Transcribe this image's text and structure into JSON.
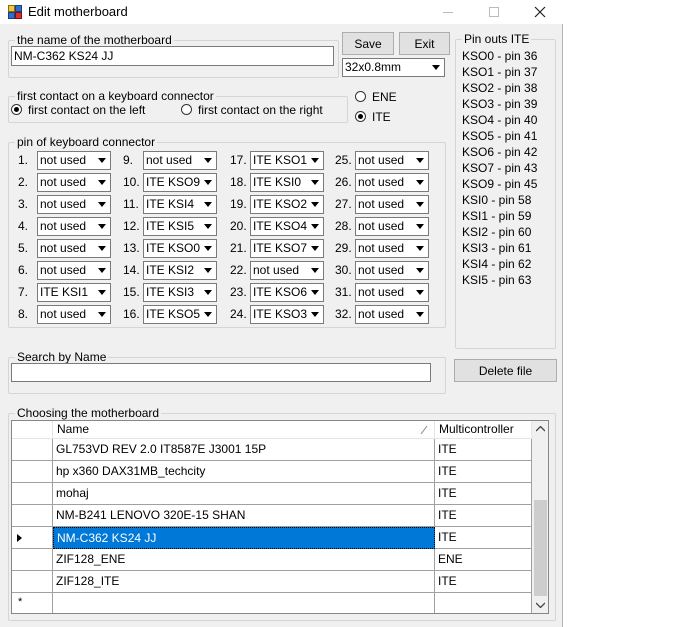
{
  "window": {
    "title": "Edit motherboard"
  },
  "name_group": {
    "legend": "the name of the motherboard",
    "value": "NM-C362 KS24 JJ"
  },
  "buttons": {
    "save": "Save",
    "exit": "Exit",
    "delete": "Delete file"
  },
  "package_select": {
    "value": "32x0.8mm"
  },
  "first_contact": {
    "legend": "first contact on a keyboard connector",
    "left_label": "first contact on the left",
    "right_label": "first contact on the right",
    "selected": "left"
  },
  "controller": {
    "ene_label": "ENE",
    "ite_label": "ITE",
    "selected": "ITE"
  },
  "pins": {
    "legend": "pin of keyboard connector",
    "items": [
      {
        "num": "1.",
        "value": "not used"
      },
      {
        "num": "2.",
        "value": "not used"
      },
      {
        "num": "3.",
        "value": "not used"
      },
      {
        "num": "4.",
        "value": "not used"
      },
      {
        "num": "5.",
        "value": "not used"
      },
      {
        "num": "6.",
        "value": "not used"
      },
      {
        "num": "7.",
        "value": "ITE KSI1"
      },
      {
        "num": "8.",
        "value": "not used"
      },
      {
        "num": "9.",
        "value": "not used"
      },
      {
        "num": "10.",
        "value": "ITE KSO9"
      },
      {
        "num": "11.",
        "value": "ITE KSI4"
      },
      {
        "num": "12.",
        "value": "ITE KSI5"
      },
      {
        "num": "13.",
        "value": "ITE KSO0"
      },
      {
        "num": "14.",
        "value": "ITE KSI2"
      },
      {
        "num": "15.",
        "value": "ITE KSI3"
      },
      {
        "num": "16.",
        "value": "ITE KSO5"
      },
      {
        "num": "17.",
        "value": "ITE KSO1"
      },
      {
        "num": "18.",
        "value": "ITE KSI0"
      },
      {
        "num": "19.",
        "value": "ITE KSO2"
      },
      {
        "num": "20.",
        "value": "ITE KSO4"
      },
      {
        "num": "21.",
        "value": "ITE KSO7"
      },
      {
        "num": "22.",
        "value": "not used"
      },
      {
        "num": "23.",
        "value": "ITE KSO6"
      },
      {
        "num": "24.",
        "value": "ITE KSO3"
      },
      {
        "num": "25.",
        "value": "not used"
      },
      {
        "num": "26.",
        "value": "not used"
      },
      {
        "num": "27.",
        "value": "not used"
      },
      {
        "num": "28.",
        "value": "not used"
      },
      {
        "num": "29.",
        "value": "not used"
      },
      {
        "num": "30.",
        "value": "not used"
      },
      {
        "num": "31.",
        "value": "not used"
      },
      {
        "num": "32.",
        "value": "not used"
      }
    ]
  },
  "pinouts": {
    "legend": "Pin outs ITE",
    "lines": [
      "KSO0 - pin 36",
      "KSO1 - pin 37",
      "KSO2 - pin 38",
      "KSO3 - pin 39",
      "KSO4 - pin 40",
      "KSO5 - pin 41",
      "KSO6 - pin 42",
      "KSO7 - pin 43",
      "KSO9 - pin 45",
      "KSI0  - pin 58",
      "KSI1  - pin 59",
      "KSI2  - pin 60",
      "KSI3  - pin 61",
      "KSI4  - pin 62",
      "KSI5  - pin 63"
    ]
  },
  "search": {
    "legend": "Search by Name",
    "value": ""
  },
  "choosing": {
    "legend": "Choosing the motherboard",
    "columns": {
      "name": "Name",
      "multi": "Multicontroller"
    },
    "rows": [
      {
        "name": "GL753VD  REV 2.0  IT8587E  J3001 15P",
        "multi": "ITE"
      },
      {
        "name": "hp x360 DAX31MB_techcity",
        "multi": "ITE"
      },
      {
        "name": "mohaj",
        "multi": "ITE"
      },
      {
        "name": "NM-B241 LENOVO 320E-15 SHAN",
        "multi": "ITE"
      },
      {
        "name": "NM-C362 KS24 JJ",
        "multi": "ITE"
      },
      {
        "name": "ZIF128_ENE",
        "multi": "ENE"
      },
      {
        "name": "ZIF128_ITE",
        "multi": "ITE"
      }
    ],
    "selected_index": 4,
    "new_row_marker": "*"
  }
}
